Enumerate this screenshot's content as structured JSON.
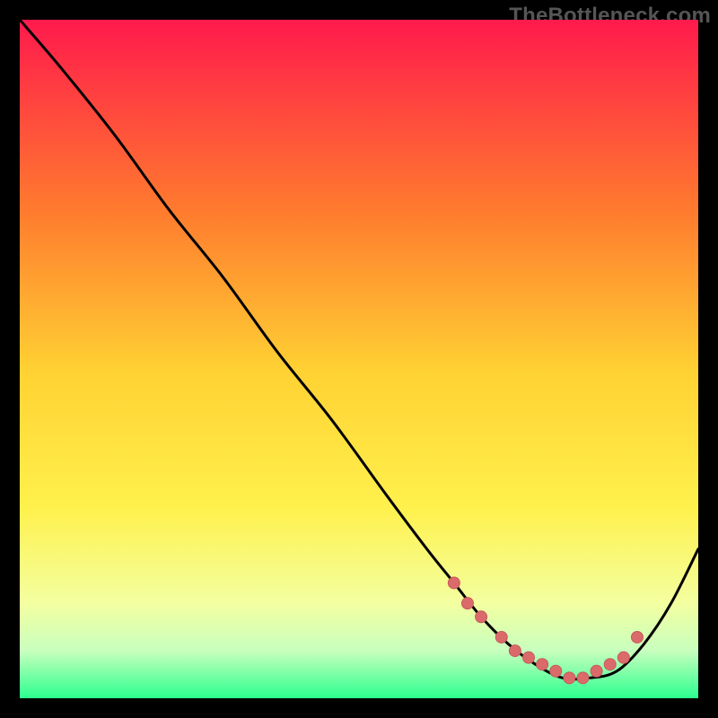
{
  "watermark": "TheBottleneck.com",
  "colors": {
    "bg_black": "#000000",
    "grad_top": "#ff1a4c",
    "grad_mid1": "#ff7a2e",
    "grad_mid2": "#ffd233",
    "grad_mid3": "#fff14d",
    "grad_low1": "#f3ffa0",
    "grad_low2": "#c8ffbe",
    "grad_bottom": "#2cff8f",
    "curve": "#000000",
    "marker_fill": "#db6b6b",
    "marker_stroke": "#c65a5a"
  },
  "chart_data": {
    "type": "line",
    "title": "",
    "xlabel": "",
    "ylabel": "",
    "xlim": [
      0,
      100
    ],
    "ylim": [
      0,
      100
    ],
    "series": [
      {
        "name": "bottleneck-curve",
        "x": [
          0,
          6,
          14,
          22,
          30,
          38,
          46,
          54,
          60,
          64,
          68,
          72,
          76,
          80,
          84,
          88,
          92,
          96,
          100
        ],
        "y": [
          100,
          93,
          83,
          72,
          62,
          51,
          41,
          30,
          22,
          17,
          12,
          8,
          5,
          3,
          3,
          4,
          8,
          14,
          22
        ]
      }
    ],
    "markers": {
      "name": "highlight-points",
      "x": [
        64,
        66,
        68,
        71,
        73,
        75,
        77,
        79,
        81,
        83,
        85,
        87,
        89,
        91
      ],
      "y": [
        17,
        14,
        12,
        9,
        7,
        6,
        5,
        4,
        3,
        3,
        4,
        5,
        6,
        9
      ]
    }
  }
}
